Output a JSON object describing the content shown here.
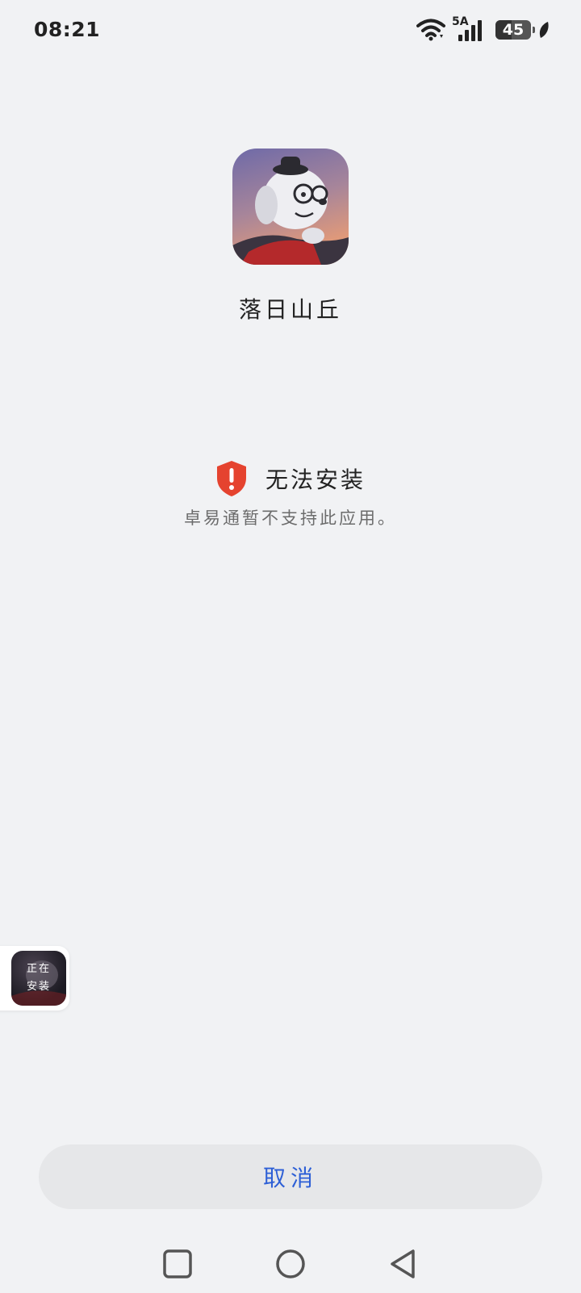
{
  "status_bar": {
    "time": "08:21",
    "network_label": "5A",
    "battery_level": "45",
    "icons": [
      "wifi-icon",
      "signal-icon",
      "battery-icon",
      "leaf-icon"
    ]
  },
  "app": {
    "name": "落日山丘",
    "icon": "app-icon"
  },
  "error": {
    "icon": "shield-alert-icon",
    "title": "无法安装",
    "description": "卓易通暂不支持此应用。",
    "color": "#e5432f"
  },
  "floating_tab": {
    "line1": "正在",
    "line2": "安装"
  },
  "actions": {
    "cancel_label": "取消",
    "cancel_color": "#2d5fd6"
  },
  "nav_bar": {
    "icons": [
      "recent-apps-icon",
      "home-icon",
      "back-icon"
    ]
  }
}
